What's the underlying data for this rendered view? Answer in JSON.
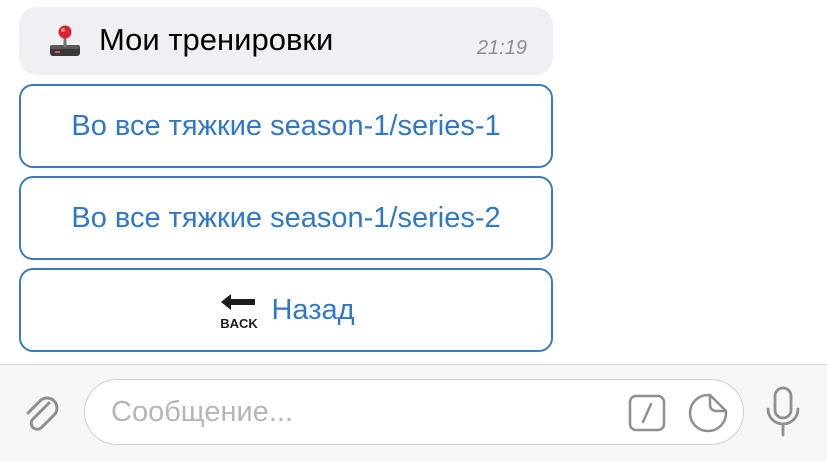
{
  "message": {
    "emoji_icon": "joystick-icon",
    "text": "Мои тренировки",
    "time": "21:19"
  },
  "keyboard": {
    "buttons": [
      {
        "label": "Во все тяжкие season-1/series-1"
      },
      {
        "label": "Во все тяжкие season-1/series-2"
      },
      {
        "label": "Назад",
        "icon": "back-arrow-icon"
      }
    ]
  },
  "composer": {
    "attach_icon": "paperclip-icon",
    "placeholder": "Сообщение...",
    "command_icon": "slash-command-icon",
    "sticker_icon": "sticker-icon",
    "mic_icon": "microphone-icon"
  },
  "colors": {
    "accent": "#2f78c9",
    "bubble": "#efeff4",
    "bar": "#f6f6f8"
  }
}
